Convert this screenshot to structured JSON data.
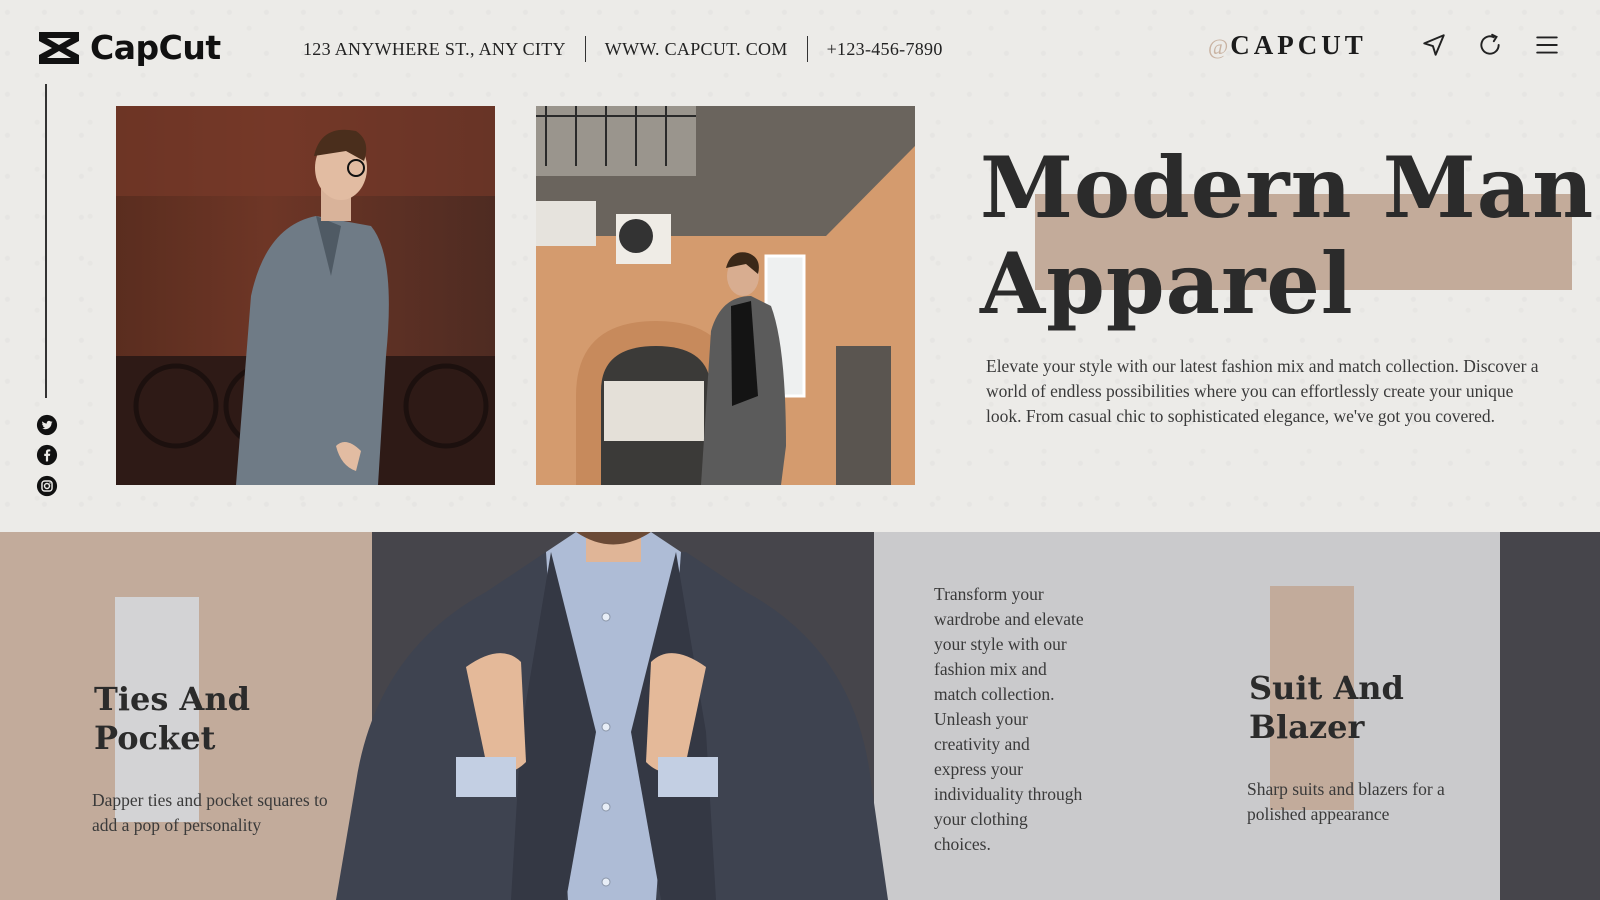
{
  "brand": {
    "name": "CapCut"
  },
  "header": {
    "address": "123 ANYWHERE ST., ANY CITY",
    "website": "WWW. CAPCUT. COM",
    "phone": "+123-456-7890",
    "handle_at": "@",
    "handle": "CAPCUT",
    "icons": [
      "send-icon",
      "refresh-icon",
      "menu-icon"
    ]
  },
  "sidebar": {
    "social": [
      "twitter-icon",
      "facebook-icon",
      "instagram-icon"
    ]
  },
  "hero": {
    "title_line1": "Modern Man",
    "title_line2": "Apparel",
    "description": "Elevate your style with our latest fashion mix and match collection. Discover a world of endless possibilities where you can effortlessly create  your unique look. From casual chic to sophisticated elegance, we've got you covered."
  },
  "features": {
    "ties": {
      "title_line1": "Ties And",
      "title_line2": "Pocket",
      "description": "Dapper ties and pocket squares to add a pop of personality"
    },
    "middle": {
      "description": "Transform your wardrobe and elevate your style with our fashion mix and match collection. Unleash your creativity and express your individuality through your clothing choices."
    },
    "suit": {
      "title_line1": "Suit And",
      "title_line2": "Blazer",
      "description": "Sharp suits and blazers for a polished appearance"
    }
  },
  "colors": {
    "tan": "#c2ab9b",
    "dark": "#46454b",
    "grey": "#cacacc",
    "paper": "#ecebe8",
    "text": "#2b2b2b"
  }
}
